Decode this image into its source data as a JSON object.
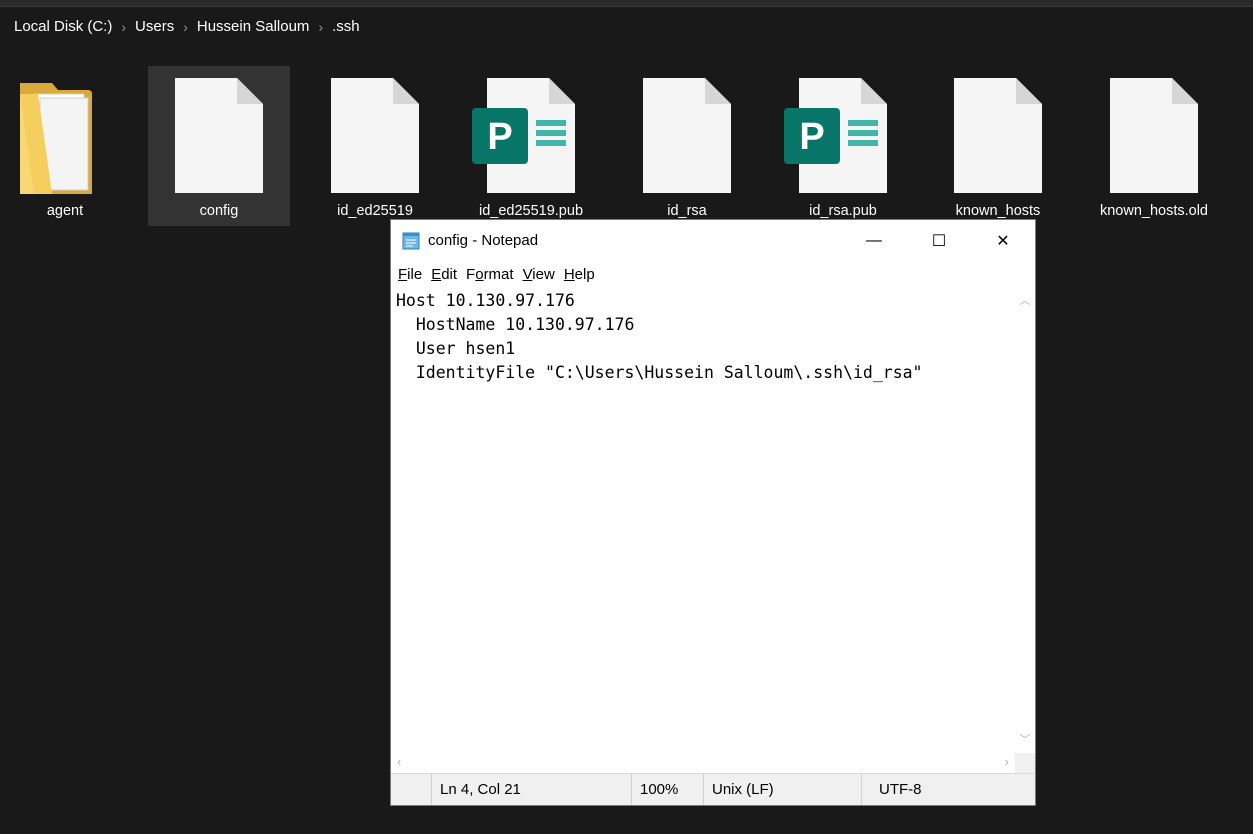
{
  "explorer": {
    "breadcrumb": [
      "Local Disk (C:)",
      "Users",
      "Hussein Salloum",
      ".ssh"
    ],
    "files": [
      {
        "name": "agent",
        "icon": "folder-icon"
      },
      {
        "name": "config",
        "icon": "blank-file-icon"
      },
      {
        "name": "id_ed25519",
        "icon": "blank-file-icon"
      },
      {
        "name": "id_ed25519.pub",
        "icon": "publisher-file-icon"
      },
      {
        "name": "id_rsa",
        "icon": "blank-file-icon"
      },
      {
        "name": "id_rsa.pub",
        "icon": "publisher-file-icon"
      },
      {
        "name": "known_hosts",
        "icon": "blank-file-icon"
      },
      {
        "name": "known_hosts.old",
        "icon": "blank-file-icon"
      }
    ],
    "selected_file": "config"
  },
  "notepad": {
    "title": "config - Notepad",
    "controls": {
      "minimize": "—",
      "maximize": "☐",
      "close": "✕"
    },
    "menu": [
      {
        "label": "File",
        "mnemonic": "F"
      },
      {
        "label": "Edit",
        "mnemonic": "E"
      },
      {
        "label": "Format",
        "mnemonic": "o"
      },
      {
        "label": "View",
        "mnemonic": "V"
      },
      {
        "label": "Help",
        "mnemonic": "H"
      }
    ],
    "content": "Host 10.130.97.176\n  HostName 10.130.97.176\n  User hsen1\n  IdentityFile \"C:\\Users\\Hussein Salloum\\.ssh\\id_rsa\"",
    "status": {
      "position": "Ln 4, Col 21",
      "zoom": "100%",
      "line_ending": "Unix (LF)",
      "encoding": "UTF-8"
    }
  },
  "colors": {
    "explorer_bg": "#191919",
    "selection_bg": "#333333",
    "folder_yellow": "#f8d775",
    "publisher_teal": "#077568"
  }
}
